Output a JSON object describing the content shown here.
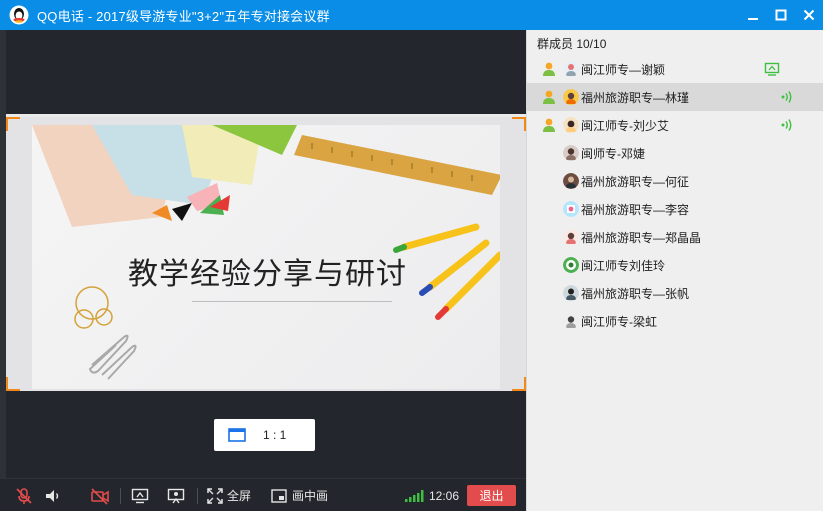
{
  "window": {
    "title": "QQ电话 - 2017级导游专业\"3+2\"五年专对接会议群",
    "controls": [
      "minimize-icon",
      "maximize-icon",
      "close-icon"
    ]
  },
  "slide": {
    "title": "教学经验分享与研讨"
  },
  "view": {
    "ratio_label": "1 : 1"
  },
  "toolbar": {
    "mic_icon": "mic-muted-icon",
    "speaker_icon": "speaker-icon",
    "camera_icon": "camera-off-icon",
    "share_icon": "screen-share-icon",
    "present_icon": "presentation-icon",
    "fullscreen_label": "全屏",
    "pip_label": "画中画",
    "time": "12:06",
    "exit_label": "退出",
    "signal_color": "#3fbf3f",
    "exit_color": "#e34c4c"
  },
  "sidebar": {
    "count_label": "群成员 10/10",
    "members": [
      {
        "name": "闽江师专—谢颖",
        "status": "user-icon",
        "right": "screen-share-icon",
        "selected": false
      },
      {
        "name": "福州旅游职专—林瑾",
        "status": "user-icon",
        "right": "speaking-icon",
        "selected": true
      },
      {
        "name": "闽江师专-刘少艾",
        "status": "user-icon",
        "right": "speaking-icon",
        "selected": false
      },
      {
        "name": "闽师专-邓婕",
        "status": "",
        "right": "",
        "selected": false
      },
      {
        "name": "福州旅游职专—何征",
        "status": "",
        "right": "",
        "selected": false
      },
      {
        "name": "福州旅游职专—李容",
        "status": "",
        "right": "",
        "selected": false
      },
      {
        "name": "福州旅游职专—郑晶晶",
        "status": "",
        "right": "",
        "selected": false
      },
      {
        "name": "闽江师专刘佳玲",
        "status": "",
        "right": "",
        "selected": false
      },
      {
        "name": "福州旅游职专—张帆",
        "status": "",
        "right": "",
        "selected": false
      },
      {
        "name": "闽江师专-梁虹",
        "status": "",
        "right": "",
        "selected": false
      }
    ]
  }
}
